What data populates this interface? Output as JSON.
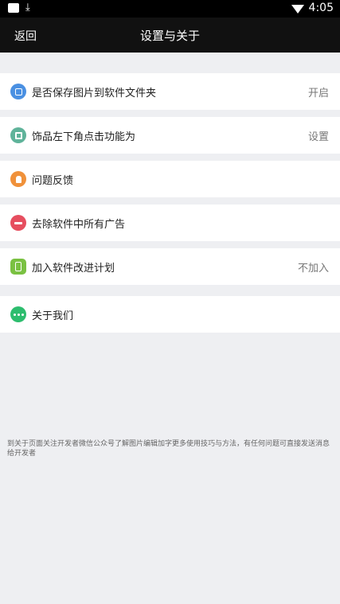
{
  "status_bar": {
    "time": "4:05",
    "left_icons": [
      "photo-icon",
      "download-icon"
    ],
    "right_icons": [
      "wifi-icon"
    ]
  },
  "navbar": {
    "back_label": "返回",
    "title": "设置与关于"
  },
  "settings": [
    {
      "label": "是否保存图片到软件文件夹",
      "value": "开启",
      "icon": "save-folder-icon",
      "color": "#4a90e2"
    },
    {
      "label": "饰品左下角点击功能为",
      "value": "设置",
      "icon": "ornament-icon",
      "color": "#5fb39a"
    },
    {
      "label": "问题反馈",
      "value": "",
      "icon": "feedback-icon",
      "color": "#f0913a"
    },
    {
      "label": "去除软件中所有广告",
      "value": "",
      "icon": "remove-ads-icon",
      "color": "#e64e5f"
    },
    {
      "label": "加入软件改进计划",
      "value": "不加入",
      "icon": "phone-icon",
      "color": "#7ac142"
    },
    {
      "label": "关于我们",
      "value": "",
      "icon": "more-icon",
      "color": "#2dbd6e"
    }
  ],
  "footer_note": "到关于页面关注开发者微信公众号了解图片编辑加字更多使用技巧与方法，有任何问题可直接发送消息给开发者"
}
